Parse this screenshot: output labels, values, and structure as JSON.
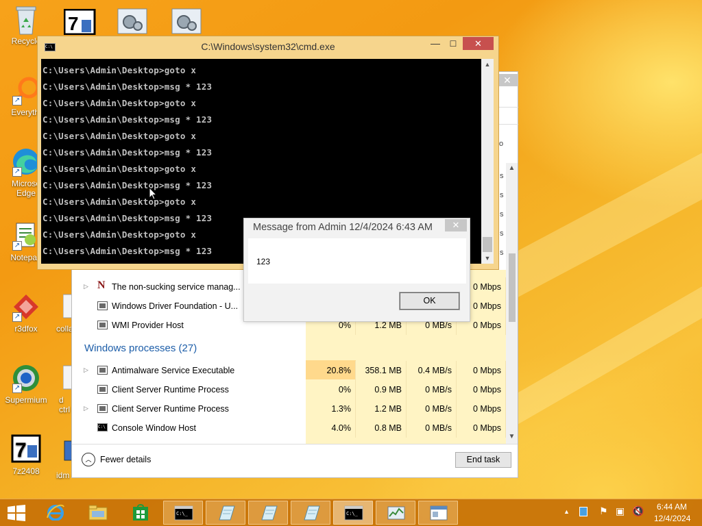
{
  "desktop": {
    "icons": [
      {
        "label": "Recycle",
        "icon": "recycle-bin-icon"
      },
      {
        "label": "Everythi",
        "icon": "everything-icon"
      },
      {
        "label": "Microso Edge",
        "icon": "edge-icon"
      },
      {
        "label": "Notepad",
        "icon": "notepad-icon"
      },
      {
        "label": "r3dfox",
        "icon": "r3dfox-icon"
      },
      {
        "label": "Supermium",
        "icon": "supermium-icon"
      },
      {
        "label": "7z2408",
        "icon": "7zip-icon"
      },
      {
        "label": "colla",
        "icon": "file-icon"
      },
      {
        "label": "d ctrl",
        "icon": "file-icon"
      },
      {
        "label": "idm",
        "icon": "file-icon"
      }
    ]
  },
  "cmd_window": {
    "title": "C:\\Windows\\system32\\cmd.exe",
    "icon_text": "C:\\",
    "minimize": "—",
    "maximize": "☐",
    "close": "✕",
    "lines": [
      "C:\\Users\\Admin\\Desktop>goto x",
      "C:\\Users\\Admin\\Desktop>msg * 123",
      "C:\\Users\\Admin\\Desktop>goto x",
      "C:\\Users\\Admin\\Desktop>msg * 123",
      "C:\\Users\\Admin\\Desktop>goto x",
      "C:\\Users\\Admin\\Desktop>msg * 123",
      "C:\\Users\\Admin\\Desktop>goto x",
      "C:\\Users\\Admin\\Desktop>msg * 123",
      "C:\\Users\\Admin\\Desktop>goto x",
      "C:\\Users\\Admin\\Desktop>msg * 123",
      "C:\\Users\\Admin\\Desktop>goto x",
      "C:\\Users\\Admin\\Desktop>msg * 123"
    ]
  },
  "message_dialog": {
    "title": "Message from Admin 12/4/2024 6:43 AM",
    "body": "123",
    "ok_label": "OK",
    "close": "✕"
  },
  "task_manager": {
    "close": "✕",
    "rows": [
      {
        "name": "The non-sucking service manag...",
        "expandable": true,
        "icon": "nssm-icon",
        "cpu": "",
        "memory": "",
        "disk": "",
        "network": "0 Mbps"
      },
      {
        "name": "Windows Driver Foundation - U...",
        "expandable": false,
        "icon": "service-icon",
        "cpu": "",
        "memory": "",
        "disk": "",
        "network": "0 Mbps"
      },
      {
        "name": "WMI Provider Host",
        "expandable": false,
        "icon": "wmi-icon",
        "cpu": "0%",
        "memory": "1.2 MB",
        "disk": "0 MB/s",
        "network": "0 Mbps"
      }
    ],
    "group_title": "Windows processes (27)",
    "windows_rows": [
      {
        "name": "Antimalware Service Executable",
        "expandable": true,
        "icon": "service-icon",
        "cpu": "20.8%",
        "memory": "358.1 MB",
        "disk": "0.4 MB/s",
        "network": "0 Mbps"
      },
      {
        "name": "Client Server Runtime Process",
        "expandable": false,
        "icon": "service-icon",
        "cpu": "0%",
        "memory": "0.9 MB",
        "disk": "0 MB/s",
        "network": "0 Mbps"
      },
      {
        "name": "Client Server Runtime Process",
        "expandable": true,
        "icon": "service-icon",
        "cpu": "1.3%",
        "memory": "1.2 MB",
        "disk": "0 MB/s",
        "network": "0 Mbps"
      },
      {
        "name": "Console Window Host",
        "expandable": false,
        "icon": "console-icon",
        "cpu": "4.0%",
        "memory": "0.8 MB",
        "disk": "0 MB/s",
        "network": "0 Mbps"
      }
    ],
    "fewer_details": "Fewer details",
    "end_task": "End task",
    "partial_header_chars": [
      "o",
      "s",
      "s",
      "s",
      "s",
      "s",
      "s"
    ]
  },
  "taskbar": {
    "items": [
      {
        "icon": "internet-explorer-icon"
      },
      {
        "icon": "file-explorer-icon"
      },
      {
        "icon": "store-icon"
      },
      {
        "icon": "cmd-icon"
      },
      {
        "icon": "notepad-taskbar-icon"
      },
      {
        "icon": "notepad-taskbar-icon"
      },
      {
        "icon": "notepad-taskbar-icon"
      },
      {
        "icon": "cmd-icon"
      },
      {
        "icon": "task-manager-icon"
      },
      {
        "icon": "message-window-icon"
      }
    ],
    "clock_time": "6:44 AM",
    "clock_date": "12/4/2024",
    "tray_chevron": "▲"
  },
  "colors": {
    "accent": "#c77106",
    "cmd_frame": "#f6d58d",
    "close_red": "#c7504e",
    "link_blue": "#1c5da8"
  }
}
